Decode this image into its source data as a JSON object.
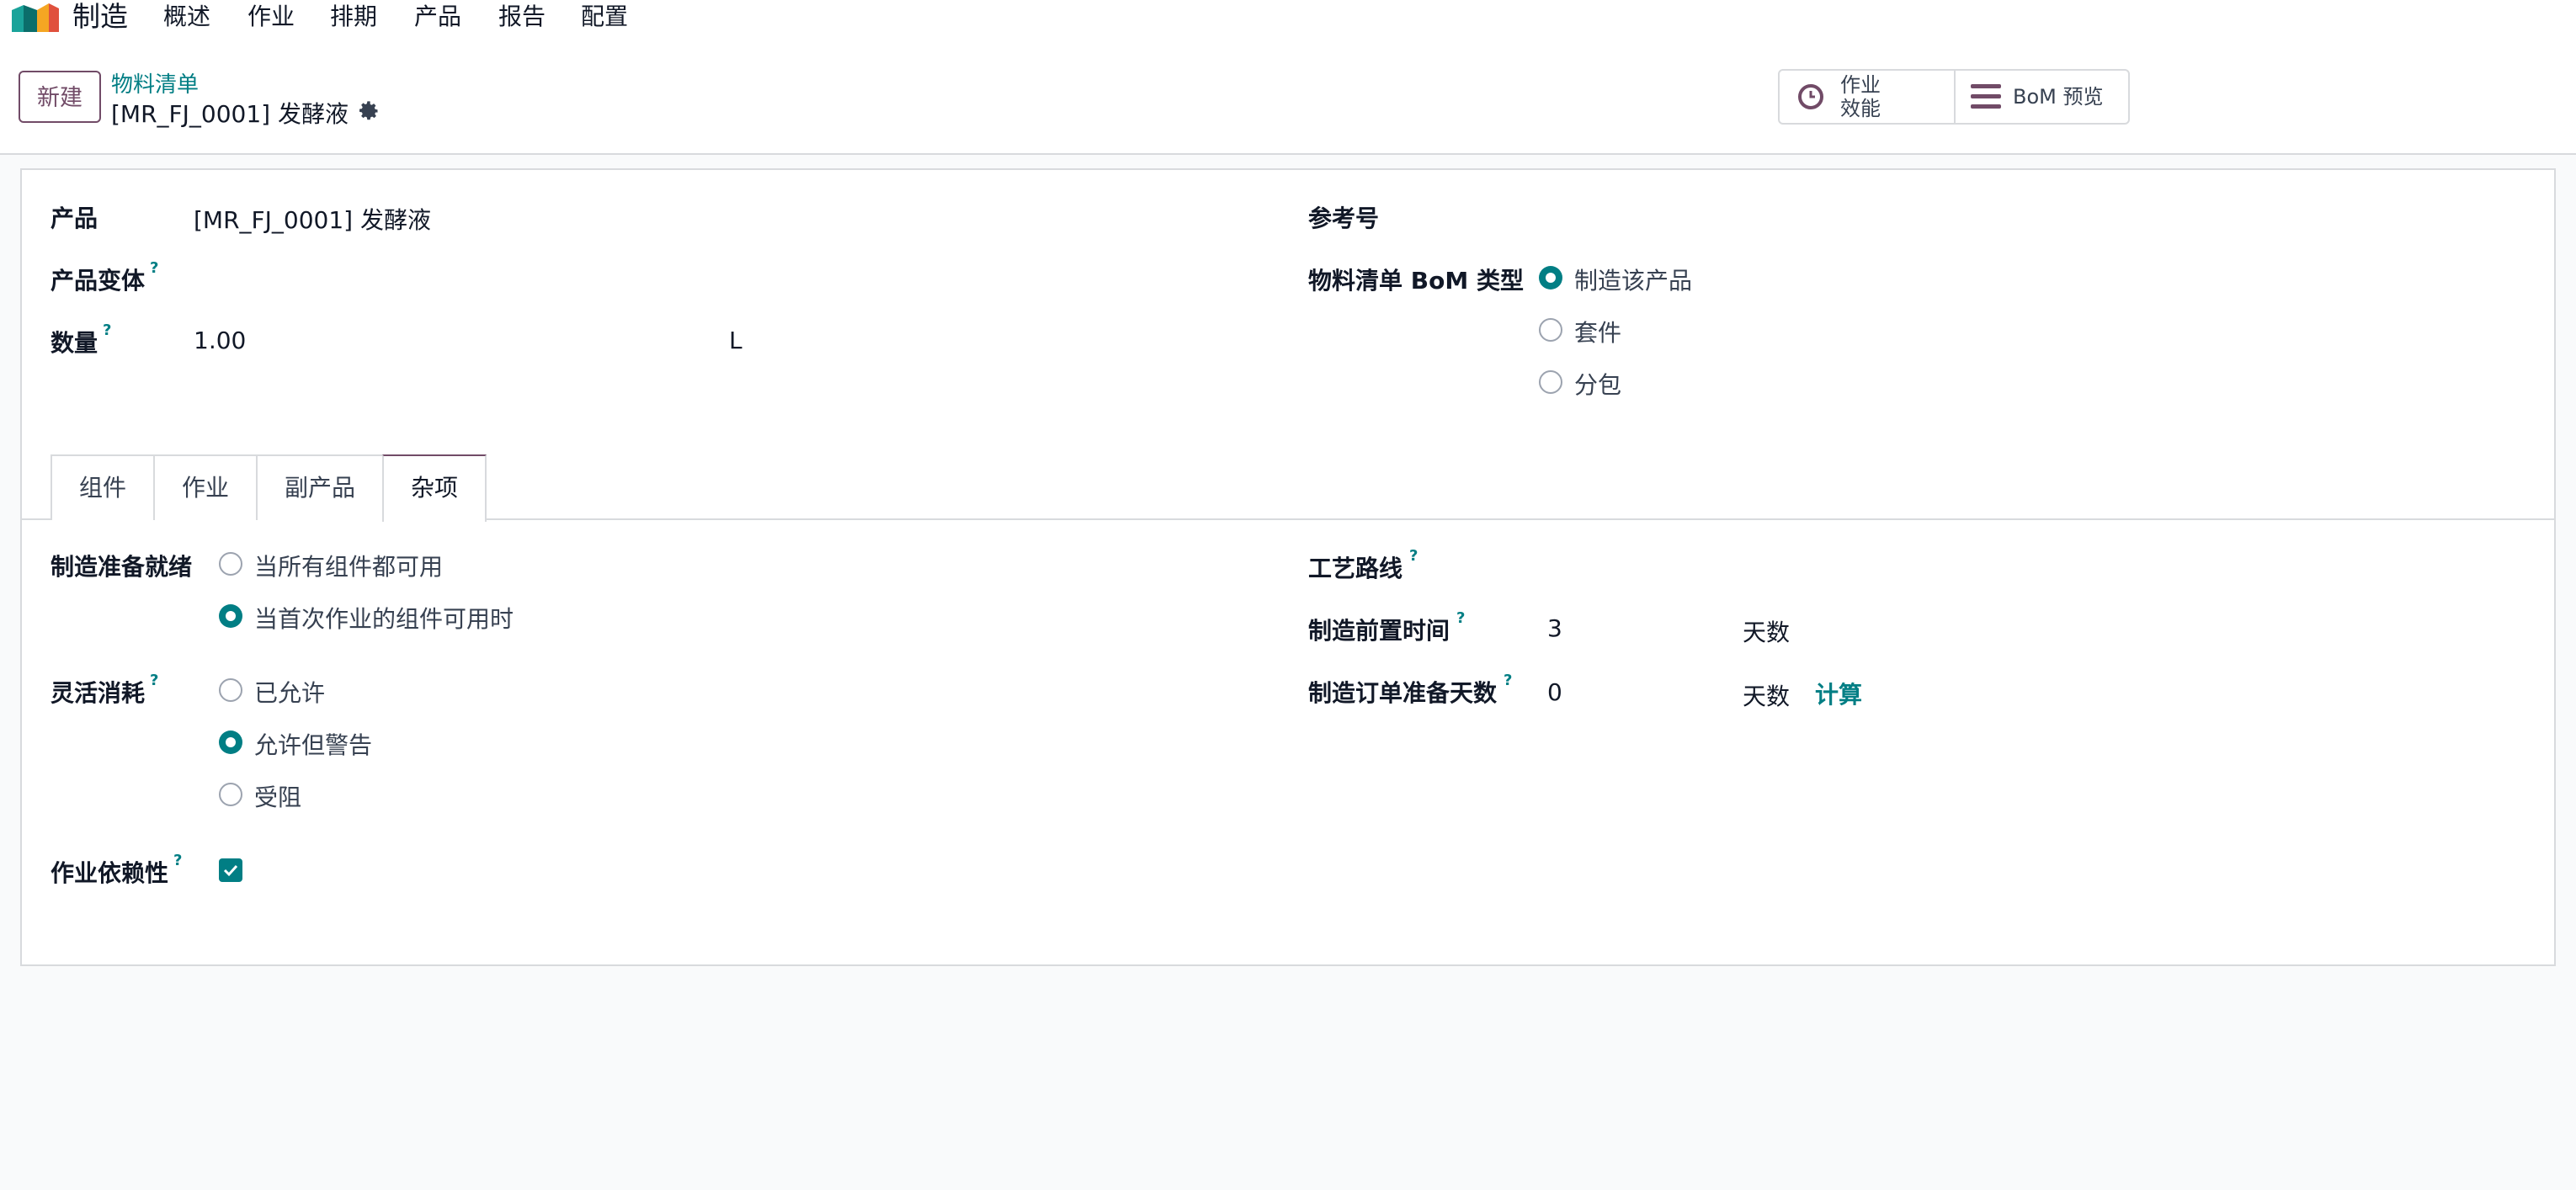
{
  "nav": {
    "app_name": "制造",
    "menus": [
      "概述",
      "作业",
      "排期",
      "产品",
      "报告",
      "配置"
    ]
  },
  "control": {
    "new_button": "新建",
    "breadcrumb": "物料清单",
    "record_title": "[MR_FJ_0001] 发酵液",
    "smart_buttons": {
      "efficiency_line1": "作业",
      "efficiency_line2": "效能",
      "bom_preview": "BoM 预览"
    }
  },
  "form": {
    "product_label": "产品",
    "product_value": "[MR_FJ_0001] 发酵液",
    "variant_label": "产品变体",
    "quantity_label": "数量",
    "quantity_value": "1.00",
    "uom_value": "L",
    "reference_label": "参考号",
    "bom_type_label": "物料清单 BoM 类型",
    "bom_type_options": [
      "制造该产品",
      "套件",
      "分包"
    ],
    "bom_type_selected": "制造该产品",
    "help_mark": "?"
  },
  "tabs": [
    "组件",
    "作业",
    "副产品",
    "杂项"
  ],
  "active_tab": "杂项",
  "misc": {
    "ready_label": "制造准备就绪",
    "ready_options": [
      "当所有组件都可用",
      "当首次作业的组件可用时"
    ],
    "ready_selected": "当首次作业的组件可用时",
    "flex_label": "灵活消耗",
    "flex_options": [
      "已允许",
      "允许但警告",
      "受阻"
    ],
    "flex_selected": "允许但警告",
    "dependency_label": "作业依赖性",
    "dependency_checked": true,
    "routing_label": "工艺路线",
    "lead_time_label": "制造前置时间",
    "lead_time_value": "3",
    "lead_time_unit": "天数",
    "prep_days_label": "制造订单准备天数",
    "prep_days_value": "0",
    "prep_days_unit": "天数",
    "compute_link": "计算"
  },
  "colors": {
    "brand": "#714b67",
    "accent": "#017e84"
  }
}
